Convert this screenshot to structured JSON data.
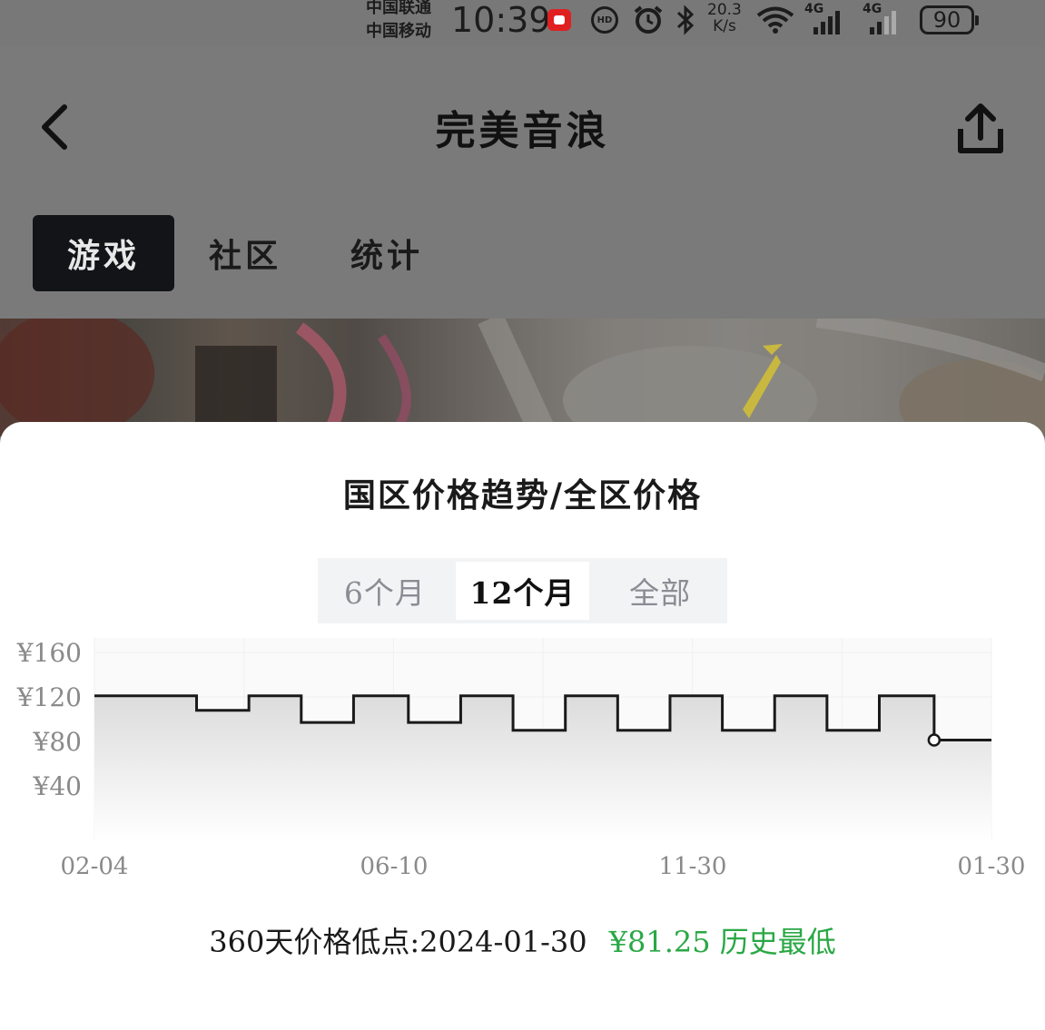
{
  "status_bar": {
    "carrier_1": "中国联通",
    "carrier_2": "中国移动",
    "time": "10:39",
    "hd_badge": "HD",
    "speed_value": "20.3",
    "speed_unit": "K/s",
    "network_1": "4G",
    "network_2": "4G",
    "battery": "90"
  },
  "header": {
    "title": "完美音浪",
    "back_icon": "chevron-left-icon",
    "share_icon": "share-icon"
  },
  "tabs": [
    {
      "label": "游戏",
      "active": true
    },
    {
      "label": "社区",
      "active": false
    },
    {
      "label": "统计",
      "active": false
    }
  ],
  "sheet": {
    "title": "国区价格趋势/全区价格",
    "ranges": [
      {
        "label": "6个月",
        "active": false
      },
      {
        "label": "12个月",
        "active": true
      },
      {
        "label": "全部",
        "active": false
      }
    ],
    "summary": {
      "label": "360天价格低点:2024-01-30",
      "price": "¥81.25 历史最低"
    }
  },
  "colors": {
    "accent_green": "#2aa845",
    "active_tab_bg": "#121418"
  },
  "chart_data": {
    "type": "line",
    "step": true,
    "y_ticks": [
      "¥160",
      "¥120",
      "¥80",
      "¥40"
    ],
    "x_ticks": [
      "02-04",
      "06-10",
      "11-30",
      "01-30"
    ],
    "ylim": [
      0,
      160
    ],
    "grid": true,
    "series": [
      {
        "points": [
          {
            "x": "2023-02-04",
            "y": 121
          },
          {
            "x": "2023-03-17",
            "y": 108
          },
          {
            "x": "2023-04-07",
            "y": 121
          },
          {
            "x": "2023-04-28",
            "y": 97
          },
          {
            "x": "2023-05-19",
            "y": 121
          },
          {
            "x": "2023-06-10",
            "y": 97
          },
          {
            "x": "2023-07-01",
            "y": 121
          },
          {
            "x": "2023-07-22",
            "y": 90
          },
          {
            "x": "2023-08-12",
            "y": 121
          },
          {
            "x": "2023-09-02",
            "y": 90
          },
          {
            "x": "2023-09-23",
            "y": 121
          },
          {
            "x": "2023-10-14",
            "y": 90
          },
          {
            "x": "2023-11-04",
            "y": 121
          },
          {
            "x": "2023-11-25",
            "y": 90
          },
          {
            "x": "2023-12-16",
            "y": 121
          },
          {
            "x": "2024-01-07",
            "y": 81.25
          },
          {
            "x": "2024-01-30",
            "y": 81.25
          }
        ]
      }
    ]
  }
}
